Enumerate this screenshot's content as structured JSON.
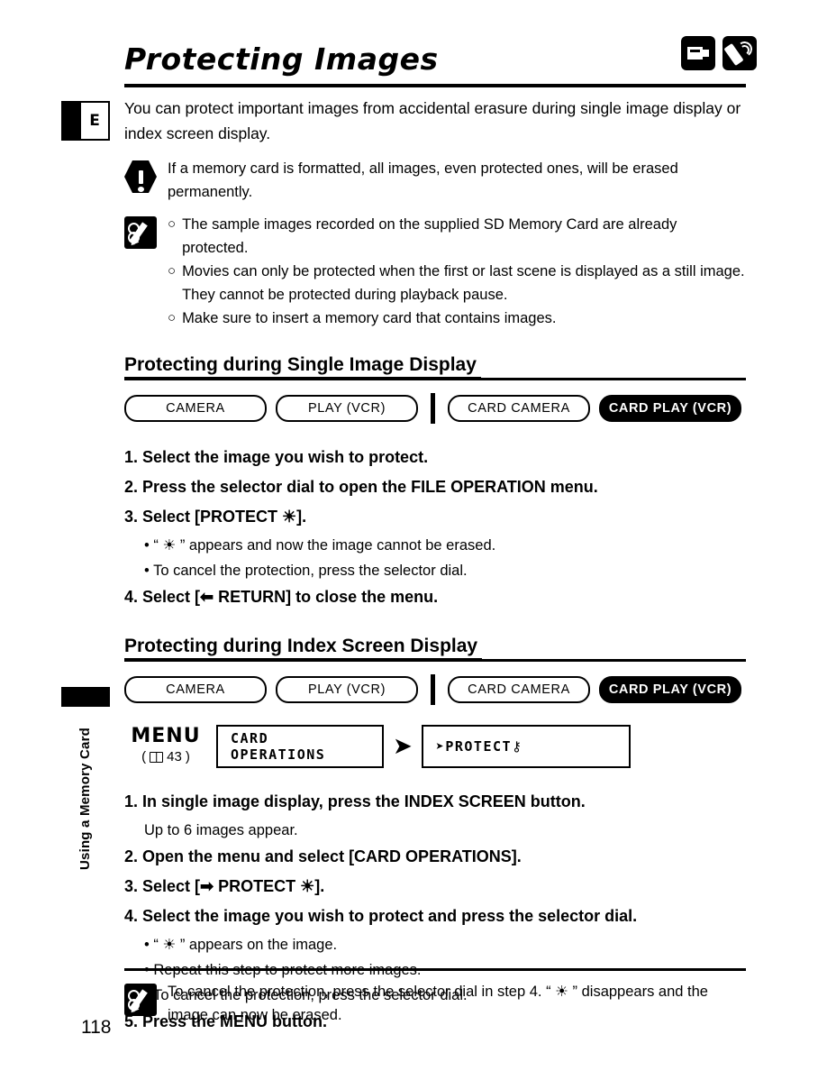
{
  "header": {
    "title": "Protecting Images",
    "icons": [
      {
        "name": "card-camera-icon",
        "label": "CARD CAMERA"
      },
      {
        "name": "remote-control-icon",
        "label": "REMOTE"
      }
    ]
  },
  "sidebar": {
    "language_badge": "E",
    "section_label": "Using a Memory Card",
    "page_number": "118"
  },
  "intro": "You can protect important images from accidental erasure during single image display or index screen display.",
  "warning": {
    "icon": "warning-icon",
    "text": "If a memory card is formatted, all images, even protected ones, will be erased permanently."
  },
  "notes": {
    "icon": "memo-icon",
    "items": [
      "The sample images recorded on the supplied SD Memory Card are already protected.",
      "Movies can only be protected when the first or last scene is displayed as a still image. They cannot be protected during playback pause.",
      "Make sure to insert a memory card that contains images."
    ]
  },
  "sections": [
    {
      "heading": "Protecting during Single Image Display",
      "modes": [
        {
          "label": "CAMERA",
          "active": false
        },
        {
          "label": "PLAY (VCR)",
          "active": false
        },
        {
          "label": "CARD CAMERA",
          "active": false
        },
        {
          "label": "CARD PLAY (VCR)",
          "active": true
        }
      ],
      "steps": [
        "1. Select the image you wish to protect.",
        "2. Press the selector dial to open the FILE OPERATION menu.",
        "3. Select [PROTECT ☀].",
        "4. Select [⬅ RETURN] to close the menu."
      ],
      "bullets_after_step3": [
        "• “ ☀ ” appears and now the image cannot be erased.",
        "• To cancel the protection, press the selector dial."
      ]
    },
    {
      "heading": "Protecting during Index Screen Display",
      "modes": [
        {
          "label": "CAMERA",
          "active": false
        },
        {
          "label": "PLAY (VCR)",
          "active": false
        },
        {
          "label": "CARD CAMERA",
          "active": false
        },
        {
          "label": "CARD PLAY (VCR)",
          "active": true
        }
      ],
      "menu_diagram": {
        "menu_word": "MENU",
        "page_ref": "43",
        "box1": "CARD OPERATIONS",
        "box2": "PROTECT",
        "arrow": "➤"
      },
      "steps": [
        "1. In single image display, press the INDEX SCREEN button.",
        "2. Open the menu and select [CARD OPERATIONS].",
        "3. Select [➡ PROTECT ☀].",
        "4. Select the image you wish to protect and press the selector dial.",
        "5. Press the MENU button."
      ],
      "step1_note": "Up to 6 images appear.",
      "bullets_after_step4": [
        "• “ ☀ ” appears on the image.",
        "• Repeat this step to protect more images.",
        "• To cancel the protection, press the selector dial."
      ]
    }
  ],
  "footer_note": {
    "icon": "memo-icon",
    "text": "To cancel the protection, press the selector dial in step 4. “ ☀ ” disappears and the image can now be erased."
  }
}
